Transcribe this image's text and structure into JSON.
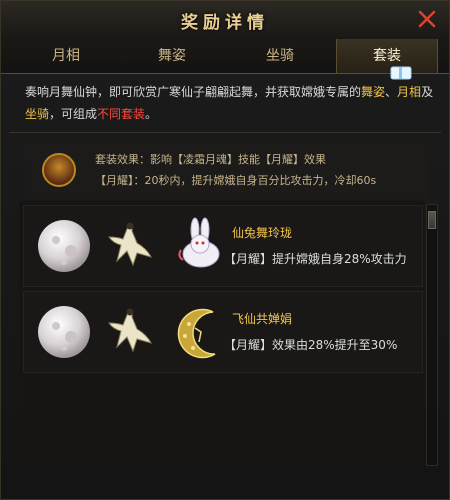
{
  "window": {
    "title": "奖励详情"
  },
  "tabs": [
    "月相",
    "舞姿",
    "坐骑",
    "套装"
  ],
  "active_tab": "套装",
  "description": {
    "part1": "奏响月舞仙钟，即可欣赏广寒仙子翩翩起舞，并获取嫦娥专属的",
    "link_dance": "舞姿",
    "sep": "、",
    "link_moon": "月相",
    "and": "及",
    "link_mount": "坐骑",
    "part2": "，可组成",
    "link_sets": "不同套装",
    "end": "。"
  },
  "set_effect": {
    "line1": "套装效果：影响【凌霜月魂】技能【月耀】效果",
    "line2": "【月耀】：20秒内，提升嫦娥自身百分比攻击力，冷却60s"
  },
  "cards": [
    {
      "name": "仙兔舞玲珑",
      "effect": "【月耀】提升嫦娥自身28%攻击力",
      "icons": [
        "moon-phase-icon",
        "dance-pose-icon",
        "rabbit-mount-icon"
      ]
    },
    {
      "name": "飞仙共婵娟",
      "effect": "【月耀】效果由28%提升至30%",
      "icons": [
        "moon-phase-icon",
        "dance-pose-icon",
        "crescent-mount-icon"
      ]
    }
  ],
  "colors": {
    "accent": "#f0c348",
    "highlight_red": "#ff4a3c",
    "title": "#e9cf93"
  }
}
